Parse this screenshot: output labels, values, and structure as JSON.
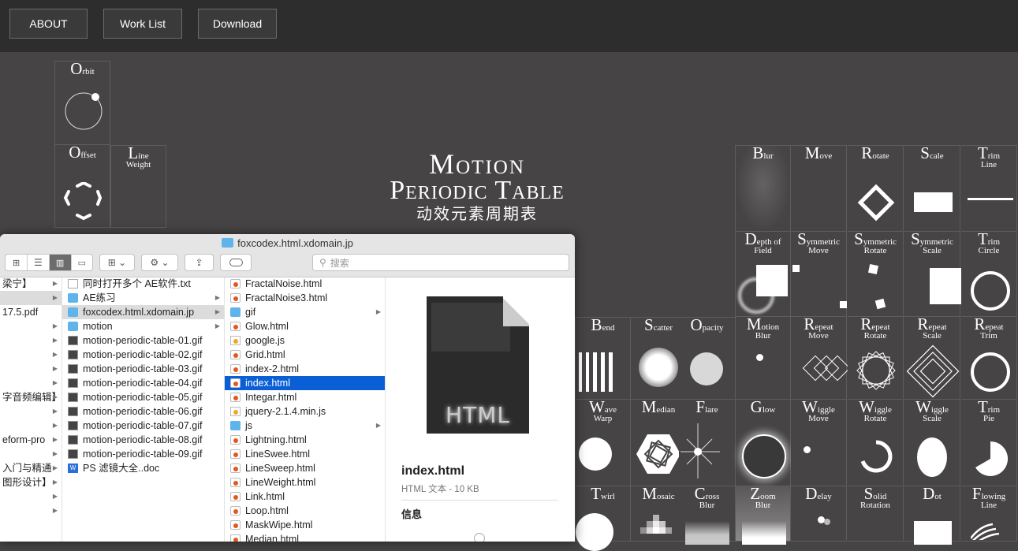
{
  "nav": {
    "about": "ABOUT",
    "worklist": "Work List",
    "download": "Download"
  },
  "title": {
    "line1": "Motion",
    "line2": "Periodic Table",
    "line3": "动效元素周期表"
  },
  "cells": {
    "orbit": {
      "big": "O",
      "rest": "rbit"
    },
    "offset": {
      "big": "O",
      "rest": "ffset"
    },
    "lineweight": {
      "big": "L",
      "rest": "ine",
      "line2": "Weight"
    },
    "blur": {
      "big": "B",
      "rest": "lur"
    },
    "move": {
      "big": "M",
      "rest": "ove"
    },
    "rotate": {
      "big": "R",
      "rest": "otate"
    },
    "scale": {
      "big": "S",
      "rest": "cale"
    },
    "trimline": {
      "big": "T",
      "rest": "rim",
      "line2": "Line"
    },
    "dof": {
      "big": "D",
      "rest": "epth of",
      "line2": "Field"
    },
    "symmove": {
      "big": "S",
      "rest": "ymmetric",
      "line2": "Move"
    },
    "symrotate": {
      "big": "S",
      "rest": "ymmetric",
      "line2": "Rotate"
    },
    "symscale": {
      "big": "S",
      "rest": "ymmetric",
      "line2": "Scale"
    },
    "trimcircle": {
      "big": "T",
      "rest": "rim",
      "line2": "Circle"
    },
    "bend": {
      "big": "B",
      "rest": "end"
    },
    "scatter": {
      "big": "S",
      "rest": "catter"
    },
    "opacity": {
      "big": "O",
      "rest": "pacity"
    },
    "motionblur": {
      "big": "M",
      "rest": "otion",
      "line2": "Blur"
    },
    "repeatmove": {
      "big": "R",
      "rest": "epeat",
      "line2": "Move"
    },
    "repeatrotate": {
      "big": "R",
      "rest": "epeat",
      "line2": "Rotate"
    },
    "repeatscale": {
      "big": "R",
      "rest": "epeat",
      "line2": "Scale"
    },
    "repeattrim": {
      "big": "R",
      "rest": "epeat",
      "line2": "Trim"
    },
    "wavewarp": {
      "big": "W",
      "rest": "ave",
      "line2": "Warp"
    },
    "median": {
      "big": "M",
      "rest": "edian"
    },
    "flare": {
      "big": "F",
      "rest": "lare"
    },
    "glow": {
      "big": "G",
      "rest": "low"
    },
    "wigglemove": {
      "big": "W",
      "rest": "iggle",
      "line2": "Move"
    },
    "wigglerotate": {
      "big": "W",
      "rest": "iggle",
      "line2": "Rotate"
    },
    "wigglescale": {
      "big": "W",
      "rest": "iggle",
      "line2": "Scale"
    },
    "trimpie": {
      "big": "T",
      "rest": "rim",
      "line2": "Pie"
    },
    "twirl": {
      "big": "T",
      "rest": "wirl"
    },
    "mosaic": {
      "big": "M",
      "rest": "osaic"
    },
    "crossblur": {
      "big": "C",
      "rest": "ross",
      "line2": "Blur"
    },
    "zoomblur": {
      "big": "Z",
      "rest": "oom",
      "line2": "Blur"
    },
    "delay": {
      "big": "D",
      "rest": "elay"
    },
    "solidrotation": {
      "big": "S",
      "rest": "olid",
      "line2": "Rotation"
    },
    "dot": {
      "big": "D",
      "rest": "ot"
    },
    "flowingline": {
      "big": "F",
      "rest": "lowing",
      "line2": "Line"
    }
  },
  "finder": {
    "window_title": "foxcodex.html.xdomain.jp",
    "search_placeholder": "搜索",
    "col1": [
      "梁宁】",
      "",
      "17.5.pdf",
      "",
      "",
      "",
      "",
      "",
      "字音频编辑】",
      "",
      "",
      "eform-pro",
      "",
      "入门与精通",
      "图形设计】",
      "",
      ""
    ],
    "col2": [
      "同时打开多个 AE软件.txt",
      "AE练习",
      "foxcodex.html.xdomain.jp",
      "motion",
      "motion-periodic-table-01.gif",
      "motion-periodic-table-02.gif",
      "motion-periodic-table-03.gif",
      "motion-periodic-table-04.gif",
      "motion-periodic-table-05.gif",
      "motion-periodic-table-06.gif",
      "motion-periodic-table-07.gif",
      "motion-periodic-table-08.gif",
      "motion-periodic-table-09.gif",
      "PS 滤镜大全..doc"
    ],
    "col3": [
      "FractalNoise.html",
      "FractalNoise3.html",
      "gif",
      "Glow.html",
      "google.js",
      "Grid.html",
      "index-2.html",
      "index.html",
      "Integar.html",
      "jquery-2.1.4.min.js",
      "js",
      "Lightning.html",
      "LineSwee.html",
      "LineSweep.html",
      "LineWeight.html",
      "Link.html",
      "Loop.html",
      "MaskWipe.html",
      "Median.html"
    ],
    "preview": {
      "thumb_label": "HTML",
      "name": "index.html",
      "kind": "HTML 文本 - 10 KB",
      "info": "信息"
    }
  }
}
